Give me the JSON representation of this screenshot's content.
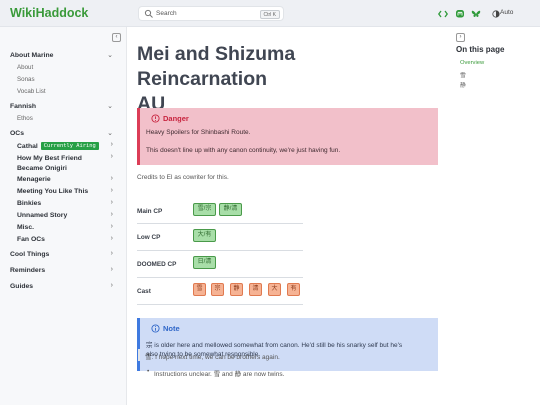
{
  "header": {
    "logo": "WikiHaddock",
    "search_placeholder": "Search",
    "search_shortcut": "Ctrl K",
    "theme_label": "Auto",
    "icons": [
      "code-icon",
      "mastodon-icon",
      "butterfly-icon",
      "theme-toggle-icon"
    ],
    "accent": "#3a9a3a"
  },
  "sidebar": {
    "collapse_glyph": "‹",
    "sections": [
      {
        "label": "About Marine",
        "children": [
          "About",
          "Sonas",
          "Vocab List"
        ]
      },
      {
        "label": "Fannish",
        "children": [
          "Ethos"
        ]
      },
      {
        "label": "OCs",
        "children": []
      }
    ],
    "oc_items": [
      {
        "label": "Cathal",
        "badge": "Currently Airing"
      },
      {
        "label": "How My Best Friend Became Onigiri"
      },
      {
        "label": "Menagerie"
      },
      {
        "label": "Meeting You Like This"
      },
      {
        "label": "Binkies"
      },
      {
        "label": "Unnamed Story"
      },
      {
        "label": "Misc."
      },
      {
        "label": "Fan OCs"
      }
    ],
    "bottom_sections": [
      "Cool Things",
      "Reminders",
      "Guides"
    ]
  },
  "main": {
    "title_line1": "Mei and Shizuma Reincarnation",
    "title_line2": "AU",
    "danger": {
      "title": "Danger",
      "p1": "Heavy Spoilers for Shinbashi Route.",
      "p2": "This doesn't line up with any canon continuity, we're just having fun."
    },
    "credits": "Credits to El as cowriter for this.",
    "rows": [
      {
        "label": "Main CP",
        "tags": [
          "雪/宗",
          "静/清"
        ],
        "style": "green"
      },
      {
        "label": "Low CP",
        "tags": [
          "大/有"
        ],
        "style": "green"
      },
      {
        "label": "DOOMED CP",
        "tags": [
          "日/清"
        ],
        "style": "green"
      },
      {
        "label": "Cast",
        "tags": [
          "雪",
          "宗",
          "静",
          "清",
          "大",
          "有"
        ],
        "style": "orange"
      }
    ],
    "note": {
      "title": "Note",
      "l1": "宗 is older here and mellowed somewhat from canon. He'd still be his snarky self but he's",
      "l2": "also trying to be somewhat responsible."
    },
    "quote": "雪: I hope next time, we can be brothers again.",
    "bullet": "•",
    "list_item": "Instructions unclear. 雪 and 静 are now twins."
  },
  "toc": {
    "collapse_glyph": "›",
    "heading": "On this page",
    "items": [
      "Overview",
      "雪",
      "静"
    ]
  }
}
